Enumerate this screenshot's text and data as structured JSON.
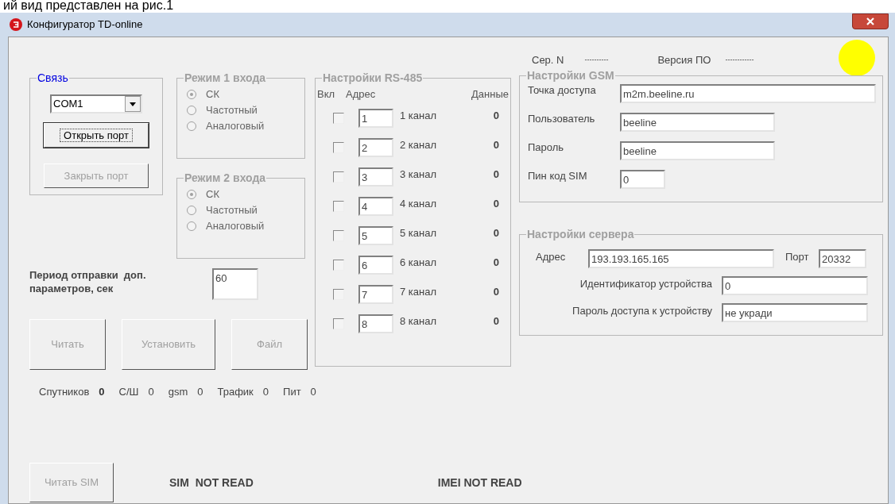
{
  "caption": "ий вид представлен на рис.1",
  "window": {
    "title": "Конфигуратор TD-online"
  },
  "connection": {
    "title": "Связь",
    "port": "COM1",
    "buttons": [
      {
        "label": "Открыть порт",
        "disabled": false
      },
      {
        "label": "Закрыть порт",
        "disabled": true
      }
    ]
  },
  "input_modes": [
    {
      "title": "Режим 1 входа",
      "disabled": true,
      "options": [
        {
          "label": "СК",
          "selected": true
        },
        {
          "label": "Частотный",
          "selected": false
        },
        {
          "label": "Аналоговый",
          "selected": false
        }
      ]
    },
    {
      "title": "Режим 2 входа",
      "disabled": true,
      "options": [
        {
          "label": "СК",
          "selected": true
        },
        {
          "label": "Частотный",
          "selected": false
        },
        {
          "label": "Аналоговый",
          "selected": false
        }
      ]
    }
  ],
  "period": {
    "label": "Период отправки  доп. параметров, сек",
    "value": "60"
  },
  "actions": [
    {
      "label": "Читать",
      "disabled": true
    },
    {
      "label": "Установить",
      "disabled": true
    },
    {
      "label": "Файл",
      "disabled": true
    }
  ],
  "status": [
    {
      "label": "Спутников",
      "value": "0",
      "bold": true
    },
    {
      "label": "С/Ш",
      "value": "0",
      "bold": false
    },
    {
      "label": "gsm",
      "value": "0",
      "bold": false
    },
    {
      "label": "Трафик",
      "value": "0",
      "bold": false
    },
    {
      "label": "Пит",
      "value": "0",
      "bold": false
    }
  ],
  "rs485": {
    "title": "Настройки RS-485",
    "columns": [
      "Вкл",
      "Адрес",
      "Данные"
    ],
    "channels": [
      {
        "checked": false,
        "address": "1",
        "name": "1 канал",
        "data": "0"
      },
      {
        "checked": false,
        "address": "2",
        "name": "2 канал",
        "data": "0"
      },
      {
        "checked": false,
        "address": "3",
        "name": "3 канал",
        "data": "0"
      },
      {
        "checked": false,
        "address": "4",
        "name": "4 канал",
        "data": "0"
      },
      {
        "checked": false,
        "address": "5",
        "name": "5 канал",
        "data": "0"
      },
      {
        "checked": false,
        "address": "6",
        "name": "6 канал",
        "data": "0"
      },
      {
        "checked": false,
        "address": "7",
        "name": "7 канал",
        "data": "0"
      },
      {
        "checked": false,
        "address": "8",
        "name": "8 канал",
        "data": "0"
      }
    ]
  },
  "device": {
    "serial_label": "Сер. N",
    "serial": "----------",
    "version_label": "Версия ПО",
    "version": "------------",
    "indicator": {
      "color": "#ffff00"
    }
  },
  "gsm": {
    "title": "Настройки GSM",
    "fields": [
      {
        "label": "Точка доступа",
        "value": "m2m.beeline.ru"
      },
      {
        "label": "Пользователь",
        "value": "beeline"
      },
      {
        "label": "Пароль",
        "value": "beeline"
      },
      {
        "label": "Пин код SIM",
        "value": "0"
      }
    ]
  },
  "server": {
    "title": "Настройки сервера",
    "address_label": "Адрес",
    "address": "193.193.165.165",
    "port_label": "Порт",
    "port": "20332",
    "fields": [
      {
        "label": "Идентификатор устройства",
        "value": "0"
      },
      {
        "label": "Пароль доступа к устройству",
        "value": "не укради"
      }
    ]
  },
  "sim": {
    "button": {
      "label": "Читать SIM",
      "disabled": true
    },
    "sim_status": "SIM  NOT READ",
    "imei_status": "IMEI NOT READ"
  }
}
